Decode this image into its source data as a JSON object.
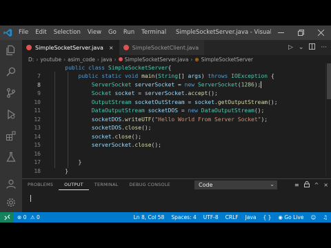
{
  "window": {
    "title": "SimpleSocketServer.java - Visual Studi...",
    "menu": [
      "File",
      "Edit",
      "Selection",
      "View",
      "Go",
      "Run",
      "Terminal"
    ]
  },
  "tabs": [
    {
      "label": "SimpleSocketServer.java",
      "active": true,
      "close": "×"
    },
    {
      "label": "SimpleSocketClient.java",
      "active": false
    }
  ],
  "editor_actions": {
    "run": "▷",
    "more": "···"
  },
  "breadcrumb": [
    "D:",
    "youtube",
    "asim_code",
    "java",
    "SimpleSocketServer.java",
    "SimpleSocketServer"
  ],
  "code": {
    "lines": [
      {
        "n": "",
        "tokens": [
          [
            "    ",
            "pl"
          ],
          [
            "public ",
            "kw"
          ],
          [
            "class ",
            "kw"
          ],
          [
            "SimpleSocketServer",
            "ty"
          ],
          [
            "{",
            "pl"
          ]
        ]
      },
      {
        "n": "7",
        "tokens": [
          [
            "        ",
            "pl"
          ],
          [
            "public ",
            "kw"
          ],
          [
            "static ",
            "kw"
          ],
          [
            "void ",
            "kw"
          ],
          [
            "main",
            "fn"
          ],
          [
            "(",
            "pl"
          ],
          [
            "String",
            "ty"
          ],
          [
            "[] ",
            "pl"
          ],
          [
            "args",
            "va"
          ],
          [
            ") ",
            "pl"
          ],
          [
            "throws ",
            "kw"
          ],
          [
            "IOException",
            "ty"
          ],
          [
            " {",
            "pl"
          ]
        ]
      },
      {
        "n": "8",
        "tokens": [
          [
            "            ",
            "pl"
          ],
          [
            "ServerSocket ",
            "ty"
          ],
          [
            "serverSocket",
            "va"
          ],
          [
            " = ",
            "pl"
          ],
          [
            "new ",
            "kw"
          ],
          [
            "ServerSocket",
            "ty"
          ],
          [
            "(",
            "pl"
          ],
          [
            "1286",
            "nu"
          ],
          [
            ");",
            "pl"
          ]
        ]
      },
      {
        "n": "9",
        "tokens": [
          [
            "            ",
            "pl"
          ],
          [
            "Socket ",
            "ty"
          ],
          [
            "socket",
            "va"
          ],
          [
            " = ",
            "pl"
          ],
          [
            "serverSocket",
            "va"
          ],
          [
            ".",
            "pl"
          ],
          [
            "accept",
            "fn"
          ],
          [
            "();",
            "pl"
          ]
        ]
      },
      {
        "n": "10",
        "tokens": [
          [
            "            ",
            "pl"
          ],
          [
            "OutputStream ",
            "ty"
          ],
          [
            "socketOutStream",
            "va"
          ],
          [
            " = ",
            "pl"
          ],
          [
            "socket",
            "va"
          ],
          [
            ".",
            "pl"
          ],
          [
            "getOutputStream",
            "fn"
          ],
          [
            "();",
            "pl"
          ]
        ]
      },
      {
        "n": "11",
        "tokens": [
          [
            "            ",
            "pl"
          ],
          [
            "DataOutputStream ",
            "ty"
          ],
          [
            "socketDOS",
            "va"
          ],
          [
            " = ",
            "pl"
          ],
          [
            "new ",
            "kw"
          ],
          [
            "DataOutputStream",
            "ty"
          ],
          [
            "();",
            "pl"
          ]
        ]
      },
      {
        "n": "12",
        "tokens": [
          [
            "            ",
            "pl"
          ],
          [
            "socketDOS",
            "va"
          ],
          [
            ".",
            "pl"
          ],
          [
            "writeUTF",
            "fn"
          ],
          [
            "(",
            "pl"
          ],
          [
            "\"Hello World From Server Socket\"",
            "st"
          ],
          [
            ");",
            "pl"
          ]
        ]
      },
      {
        "n": "13",
        "tokens": [
          [
            "            ",
            "pl"
          ],
          [
            "socketDOS",
            "va"
          ],
          [
            ".",
            "pl"
          ],
          [
            "close",
            "fn"
          ],
          [
            "();",
            "pl"
          ]
        ]
      },
      {
        "n": "14",
        "tokens": [
          [
            "            ",
            "pl"
          ],
          [
            "socket",
            "va"
          ],
          [
            ".",
            "pl"
          ],
          [
            "close",
            "fn"
          ],
          [
            "();",
            "pl"
          ]
        ]
      },
      {
        "n": "15",
        "tokens": [
          [
            "            ",
            "pl"
          ],
          [
            "serverSocket",
            "va"
          ],
          [
            ".",
            "pl"
          ],
          [
            "close",
            "fn"
          ],
          [
            "();",
            "pl"
          ]
        ]
      },
      {
        "n": "16",
        "tokens": []
      },
      {
        "n": "17",
        "tokens": [
          [
            "        ",
            "pl"
          ],
          [
            "}",
            "pl"
          ]
        ]
      },
      {
        "n": "18",
        "tokens": [
          [
            "    ",
            "pl"
          ],
          [
            "}",
            "pl"
          ]
        ]
      }
    ],
    "current_line": "8"
  },
  "panel": {
    "tabs": [
      "PROBLEMS",
      "OUTPUT",
      "TERMINAL",
      "DEBUG CONSOLE"
    ],
    "active_tab": "OUTPUT",
    "output_channel": "Code",
    "actions": [
      "≡",
      "🔒",
      "^",
      "×"
    ]
  },
  "status": {
    "errors": "0",
    "warnings": "0",
    "position": "Ln 8, Col 58",
    "spaces": "Spaces: 4",
    "encoding": "UTF-8",
    "eol": "CRLF",
    "language": "Java",
    "golive": "Go Live"
  },
  "colors": {
    "accent": "#007acc",
    "remote": "#16825d",
    "activity_bar": "#333333",
    "editor_bg": "#1e1e1e",
    "java_icon": "#e05252"
  }
}
